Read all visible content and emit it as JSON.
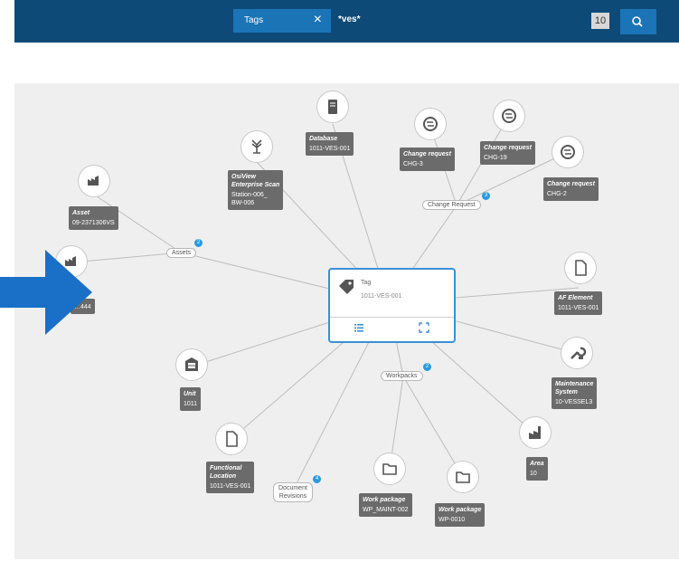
{
  "search": {
    "tag_label": "Tags",
    "clear_symbol": "×",
    "query": "*ves*",
    "result_count": "10"
  },
  "center": {
    "type": "Tag",
    "id": "1011-VES-001"
  },
  "hubs": {
    "assets": "Assets",
    "change_request": "Change Request",
    "workpacks": "Workpacks",
    "doc_rev_1": "Document",
    "doc_rev_2": "Revisions"
  },
  "badges": {
    "assets": "2",
    "change_request": "3",
    "workpacks": "2",
    "doc_rev": "4"
  },
  "cards": [
    {
      "type": "Asset",
      "value": "09-2371306VS"
    },
    {
      "type": "OsiView",
      "type2": "Enterprise Scan",
      "value": "Station-006_",
      "value2": "BW-006"
    },
    {
      "type": "Database",
      "value": "1011-VES-001"
    },
    {
      "type": "Change request",
      "value": "CHG-3"
    },
    {
      "type": "Change request",
      "value": "CHG-19"
    },
    {
      "type": "Change request",
      "value": "CHG-2"
    },
    {
      "type": "AF Element",
      "value": "1011-VES-001"
    },
    {
      "type": "Maintenance",
      "type2": "System",
      "value": "10-VESSEL3"
    },
    {
      "type": "Area",
      "value": "10"
    },
    {
      "type": "Work package",
      "value": "WP-0010"
    },
    {
      "type": "Work package",
      "value": "WP_MAINT-002"
    },
    {
      "type": "Functional",
      "type2": "Location",
      "value": "1011-VES-001"
    },
    {
      "type": "Unit",
      "value": "1011"
    },
    {
      "value": "…444"
    }
  ],
  "colors": {
    "topbar": "#0e4a78",
    "accent": "#1b74b6",
    "card": "#6b6b6b",
    "canvas": "#efefef",
    "badge": "#2a9ae0",
    "arrow": "#1a6fc6"
  },
  "icons": [
    "search-icon",
    "tag-icon",
    "list-icon",
    "expand-icon",
    "asset-icon",
    "scan-icon",
    "database-icon",
    "change-request-icon",
    "file-icon",
    "wrench-icon",
    "factory-icon",
    "folder-icon",
    "building-icon"
  ]
}
